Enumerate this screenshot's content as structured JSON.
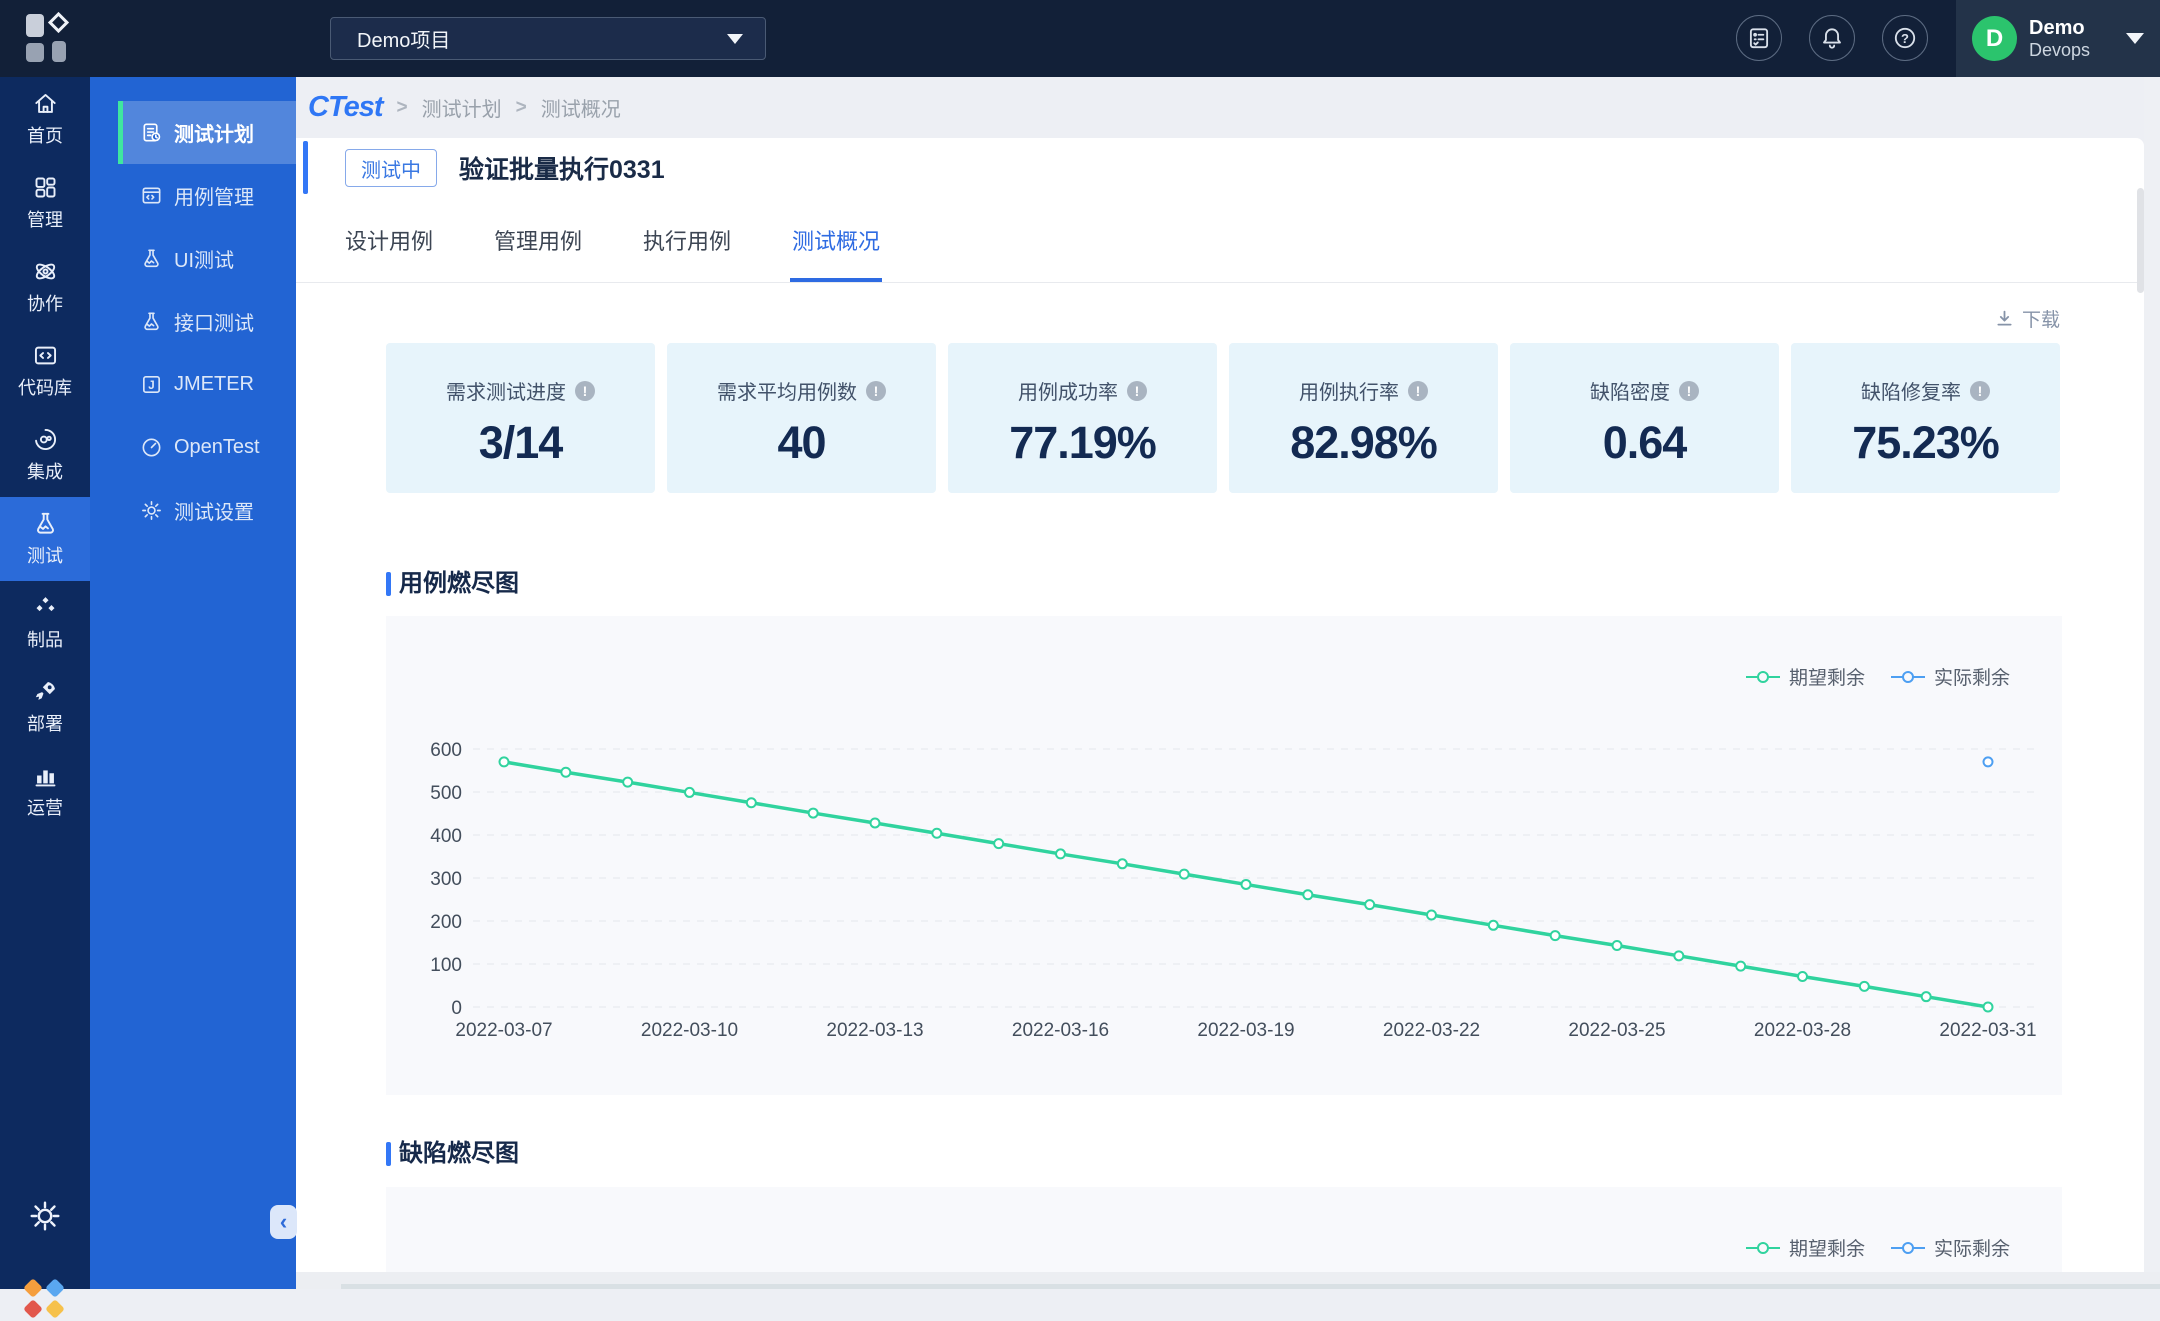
{
  "topbar": {
    "project_selector": "Demo项目",
    "icons": [
      "survey-icon",
      "bell-icon",
      "help-icon"
    ],
    "help_glyph": "?",
    "user": {
      "avatar_initial": "D",
      "name": "Demo",
      "org": "Devops"
    }
  },
  "rail": {
    "active_index": 5,
    "items": [
      {
        "label": "首页",
        "icon": "home-icon"
      },
      {
        "label": "管理",
        "icon": "grid-icon"
      },
      {
        "label": "协作",
        "icon": "collaboration-icon"
      },
      {
        "label": "代码库",
        "icon": "code-repo-icon"
      },
      {
        "label": "集成",
        "icon": "integration-icon"
      },
      {
        "label": "测试",
        "icon": "flask-icon"
      },
      {
        "label": "制品",
        "icon": "artifacts-icon"
      },
      {
        "label": "部署",
        "icon": "rocket-icon"
      },
      {
        "label": "运营",
        "icon": "bar-chart-icon"
      }
    ]
  },
  "subsidebar": {
    "active_index": 0,
    "collapse_glyph": "‹",
    "items": [
      {
        "label": "测试计划",
        "icon": "test-plan-icon"
      },
      {
        "label": "用例管理",
        "icon": "case-manage-icon"
      },
      {
        "label": "UI测试",
        "icon": "flask-icon"
      },
      {
        "label": "接口测试",
        "icon": "flask-icon"
      },
      {
        "label": "JMETER",
        "icon": "jmeter-icon",
        "icon_letter": "J"
      },
      {
        "label": "OpenTest",
        "icon": "gauge-icon"
      },
      {
        "label": "测试设置",
        "icon": "gear-icon"
      }
    ]
  },
  "breadcrumb": {
    "logo": "CTest",
    "separator": ">",
    "items": [
      "测试计划",
      "测试概况"
    ]
  },
  "plan": {
    "status_badge": "测试中",
    "title": "验证批量执行0331"
  },
  "tabs": {
    "active_index": 3,
    "items": [
      "设计用例",
      "管理用例",
      "执行用例",
      "测试概况"
    ]
  },
  "toolbar": {
    "download_label": "下载"
  },
  "stat_cards": [
    {
      "label": "需求测试进度",
      "value": "3/14",
      "info_glyph": "!"
    },
    {
      "label": "需求平均用例数",
      "value": "40",
      "info_glyph": "!"
    },
    {
      "label": "用例成功率",
      "value": "77.19%",
      "info_glyph": "!"
    },
    {
      "label": "用例执行率",
      "value": "82.98%",
      "info_glyph": "!"
    },
    {
      "label": "缺陷密度",
      "value": "0.64",
      "info_glyph": "!"
    },
    {
      "label": "缺陷修复率",
      "value": "75.23%",
      "info_glyph": "!"
    }
  ],
  "colors": {
    "topbar_bg": "#122038",
    "rail_bg": "#0D2A5F",
    "rail_active": "#2B6BD9",
    "sidebar_bg": "#2264D3",
    "sidebar_active_accent": "#3FE79F",
    "brand_blue": "#2F77F5",
    "tab_active": "#2E6BE2",
    "card_bg": "#E7F4FB",
    "stat_value": "#132A52",
    "avatar_green": "#2BC46D",
    "series_expected": "#30D39E",
    "series_actual": "#4D9FF2",
    "panel_bg": "#F8F9FC"
  },
  "chart_data": [
    {
      "type": "line",
      "title": "用例燃尽图",
      "legend_position": "top-right",
      "grid": "horizontal-dashed",
      "ylim": [
        0,
        600
      ],
      "y_ticks": [
        0,
        100,
        200,
        300,
        400,
        500,
        600
      ],
      "x_label_every": 3,
      "x": [
        "2022-03-07",
        "2022-03-08",
        "2022-03-09",
        "2022-03-10",
        "2022-03-11",
        "2022-03-12",
        "2022-03-13",
        "2022-03-14",
        "2022-03-15",
        "2022-03-16",
        "2022-03-17",
        "2022-03-18",
        "2022-03-19",
        "2022-03-20",
        "2022-03-21",
        "2022-03-22",
        "2022-03-23",
        "2022-03-24",
        "2022-03-25",
        "2022-03-26",
        "2022-03-27",
        "2022-03-28",
        "2022-03-29",
        "2022-03-30",
        "2022-03-31"
      ],
      "series": [
        {
          "name": "期望剩余",
          "color": "#30D39E",
          "values": [
            570,
            546,
            523,
            499,
            475,
            451,
            428,
            404,
            380,
            356,
            333,
            309,
            285,
            261,
            238,
            214,
            190,
            166,
            143,
            119,
            95,
            71,
            48,
            24,
            0
          ]
        },
        {
          "name": "实际剩余",
          "color": "#4D9FF2",
          "values": [
            null,
            null,
            null,
            null,
            null,
            null,
            null,
            null,
            null,
            null,
            null,
            null,
            null,
            null,
            null,
            null,
            null,
            null,
            null,
            null,
            null,
            null,
            null,
            null,
            570
          ]
        }
      ]
    },
    {
      "type": "line",
      "title": "缺陷燃尽图",
      "legend_position": "top-right",
      "clipped": true,
      "series": [
        {
          "name": "期望剩余",
          "color": "#30D39E",
          "values": []
        },
        {
          "name": "实际剩余",
          "color": "#4D9FF2",
          "values": []
        }
      ]
    }
  ]
}
